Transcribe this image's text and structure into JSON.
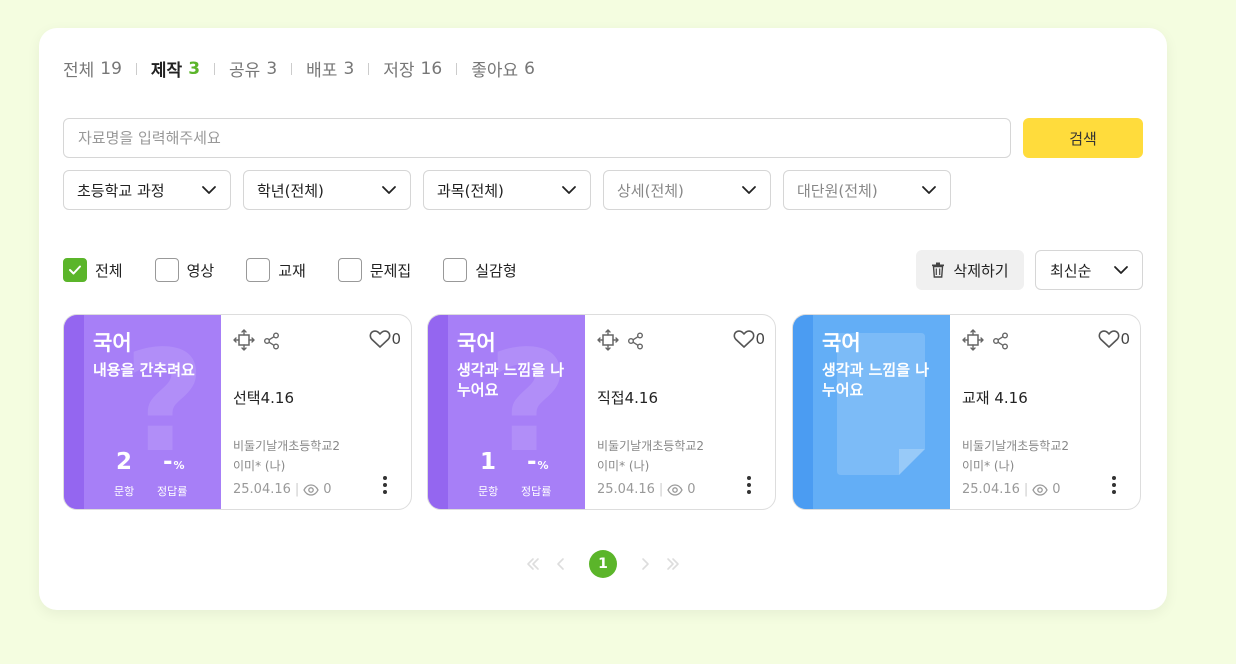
{
  "tabs": [
    {
      "label": "전체",
      "count": "19"
    },
    {
      "label": "제작",
      "count": "3"
    },
    {
      "label": "공유",
      "count": "3"
    },
    {
      "label": "배포",
      "count": "3"
    },
    {
      "label": "저장",
      "count": "16"
    },
    {
      "label": "좋아요",
      "count": "6"
    }
  ],
  "active_tab": "제작",
  "search": {
    "placeholder": "자료명을 입력해주세요",
    "value": "",
    "button": "검색"
  },
  "filters": [
    {
      "label": "초등학교 과정"
    },
    {
      "label": "학년(전체)"
    },
    {
      "label": "과목(전체)"
    },
    {
      "label": "상세(전체)"
    },
    {
      "label": "대단원(전체)"
    }
  ],
  "types": [
    {
      "label": "전체",
      "checked": true
    },
    {
      "label": "영상",
      "checked": false
    },
    {
      "label": "교재",
      "checked": false
    },
    {
      "label": "문제집",
      "checked": false
    },
    {
      "label": "실감형",
      "checked": false
    }
  ],
  "delete_label": "삭제하기",
  "sort_label": "최신순",
  "cards": [
    {
      "subject": "국어",
      "title": "내용을 간추려요",
      "question_count": "2",
      "correct_rate": "-",
      "rate_unit": "%",
      "question_label": "문항",
      "rate_label": "정답률",
      "name": "선택4.16",
      "school": "비둘기날개초등학교2",
      "author": "이미* (나)",
      "date": "25.04.16",
      "views": "0",
      "likes": "0",
      "color": "#a77ff7"
    },
    {
      "subject": "국어",
      "title": "생각과 느낌을 나누어요",
      "question_count": "1",
      "correct_rate": "-",
      "rate_unit": "%",
      "question_label": "문항",
      "rate_label": "정답률",
      "name": "직접4.16",
      "school": "비둘기날개초등학교2",
      "author": "이미* (나)",
      "date": "25.04.16",
      "views": "0",
      "likes": "0",
      "color": "#a77ff7"
    },
    {
      "subject": "국어",
      "title": "생각과 느낌을 나누어요",
      "name": "교재 4.16",
      "school": "비둘기날개초등학교2",
      "author": "이미* (나)",
      "date": "25.04.16",
      "views": "0",
      "likes": "0",
      "color": "#63aef6"
    }
  ],
  "pagination": {
    "current": "1"
  },
  "colors": {
    "accent_green": "#5bb52a",
    "search_yellow": "#ffdc3c",
    "background": "#f4fde0"
  }
}
